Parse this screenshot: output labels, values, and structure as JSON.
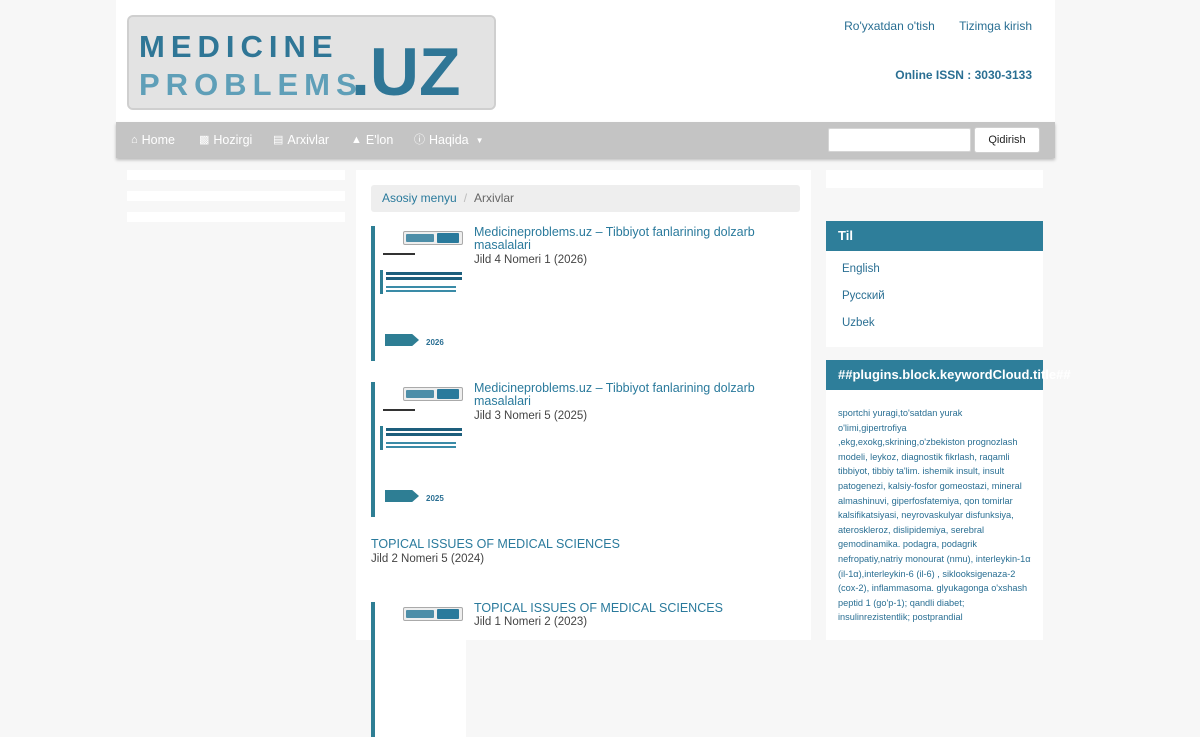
{
  "logo": {
    "line1": "MEDICINE",
    "line2": "PROBLEMS",
    "tld": ".UZ"
  },
  "header": {
    "register": "Ro'yxatdan o'tish",
    "login": "Tizimga kirish",
    "issn": "Online ISSN : 3030-3133"
  },
  "nav": {
    "items": [
      {
        "label": "Home",
        "icon": "home-icon"
      },
      {
        "label": "Hozirgi",
        "icon": "book-icon"
      },
      {
        "label": "Arxivlar",
        "icon": "archive-icon"
      },
      {
        "label": "E'lon",
        "icon": "bell-icon"
      },
      {
        "label": "Haqida",
        "icon": "info-icon"
      }
    ],
    "search_value": "",
    "search_button": "Qidirish"
  },
  "breadcrumb": {
    "home": "Asosiy menyu",
    "current": "Arxivlar"
  },
  "issues": [
    {
      "title": "Medicineproblems.uz – Tibbiyot fanlarining dolzarb masalalari",
      "series": "Jild 4 Nomeri 1 (2026)",
      "cover_year": "2026"
    },
    {
      "title": "Medicineproblems.uz – Tibbiyot fanlarining dolzarb masalalari",
      "series": "Jild 3 Nomeri 5 (2025)",
      "cover_year": "2025"
    },
    {
      "title": "TOPICAL ISSUES OF MEDICAL SCIENCES",
      "series": "Jild 2 Nomeri 5 (2024)"
    },
    {
      "title": "TOPICAL ISSUES OF MEDICAL SCIENCES",
      "series": "Jild 1 Nomeri 2 (2023)"
    }
  ],
  "sidebar": {
    "language": {
      "title": "Til",
      "options": [
        "English",
        "Русский",
        "Uzbek"
      ]
    },
    "keywords": {
      "title": "##plugins.block.keywordCloud.title##",
      "text": "sportchi yuragi,to'satdan yurak o'limi,gipertrofiya ,ekg,exokg,skrining,o'zbekiston prognozlash modeli, leykoz, diagnostik fikrlash, raqamli tibbiyot, tibbiy ta'lim. ishemik insult, insult patogenezi, kalsiy-fosfor gomeostazi, mineral almashinuvi, giperfosfatemiya, qon tomirlar kalsifikatsiyasi, neyrovaskulyar disfunksiya, ateroskleroz, dislipidemiya, serebral gemodinamika. podagra, podagrik nefropatiy,natriy monourat (nmu), interleykin-1α (il-1α),interleykin-6 (il-6) , siklooksigenaza-2 (cox-2), inflammasoma. glyukagonga o'xshash peptid 1 (go'p-1); qandli diabet; insulinrezistentlik; postprandial"
    }
  },
  "colors": {
    "accent": "#2e7e9a",
    "link": "#2a7a9c",
    "navbar": "#c4c4c4"
  }
}
